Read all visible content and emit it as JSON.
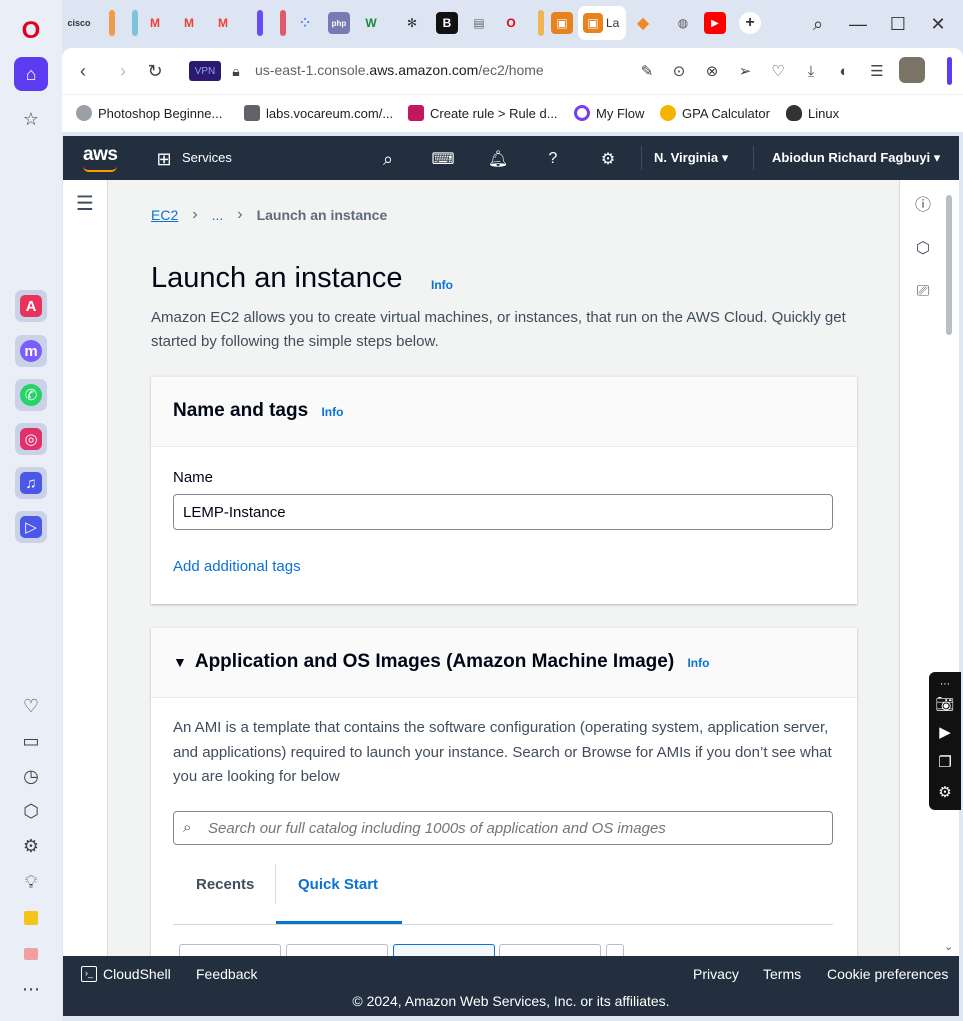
{
  "browser": {
    "url_prefix": "us-east-1.console.",
    "url_domain": "aws.amazon.com",
    "url_suffix": "/ec2/home",
    "vpn_label": "VPN",
    "active_tab_label": "La",
    "bookmarks": [
      {
        "label": "Photoshop Beginne..."
      },
      {
        "label": "labs.vocareum.com/..."
      },
      {
        "label": "Create rule > Rule d..."
      },
      {
        "label": "My Flow"
      },
      {
        "label": "GPA Calculator"
      },
      {
        "label": "Linux"
      }
    ]
  },
  "aws_nav": {
    "logo": "aws",
    "services_label": "Services",
    "region_label": "N. Virginia",
    "account_label": "Abiodun Richard Fagbuyi"
  },
  "breadcrumb": {
    "root": "EC2",
    "ellipsis": "...",
    "current": "Launch an instance"
  },
  "page": {
    "title": "Launch an instance",
    "info": "Info",
    "description": "Amazon EC2 allows you to create virtual machines, or instances, that run on the AWS Cloud. Quickly get started by following the simple steps below."
  },
  "name_tags": {
    "title": "Name and tags",
    "info": "Info",
    "name_label": "Name",
    "name_value": "LEMP-Instance",
    "add_tags_label": "Add additional tags"
  },
  "ami": {
    "title": "Application and OS Images (Amazon Machine Image)",
    "info": "Info",
    "description": "An AMI is a template that contains the software configuration (operating system, application server, and applications) required to launch your instance. Search or Browse for AMIs if you don’t see what you are looking for below",
    "search_placeholder": "Search our full catalog including 1000s of application and OS images",
    "tabs": [
      {
        "label": "Recents",
        "selected": false
      },
      {
        "label": "Quick Start",
        "selected": true
      }
    ]
  },
  "footer": {
    "cloudshell": "CloudShell",
    "feedback": "Feedback",
    "privacy": "Privacy",
    "terms": "Terms",
    "cookie": "Cookie preferences",
    "copyright": "© 2024, Amazon Web Services, Inc. or its affiliates."
  },
  "colors": {
    "aws_nav_bg": "#232f3e",
    "link_blue": "#0972d3",
    "aws_orange": "#ff9900"
  }
}
